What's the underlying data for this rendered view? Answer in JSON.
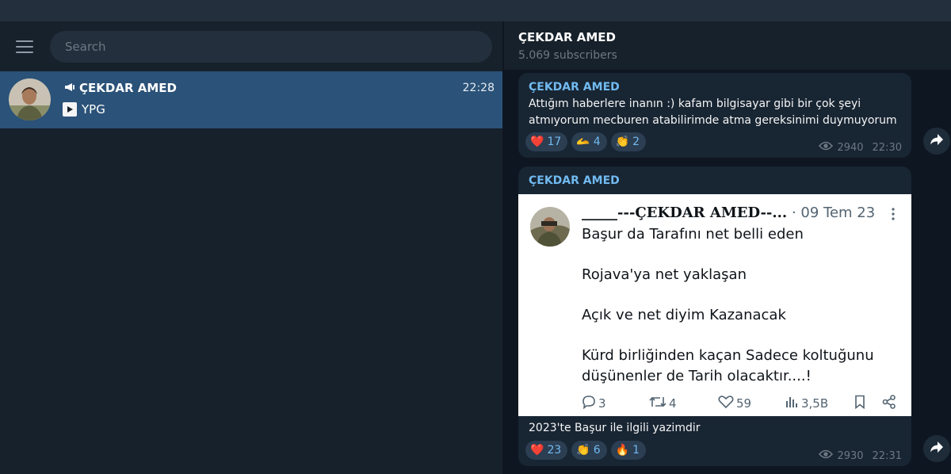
{
  "sidebar": {
    "search_placeholder": "Search",
    "chat": {
      "name": "ÇEKDAR AMED",
      "time": "22:28",
      "preview": "YPG"
    }
  },
  "header": {
    "title": "ÇEKDAR AMED",
    "subtitle": "5.069 subscribers"
  },
  "messages": [
    {
      "sender": "ÇEKDAR AMED",
      "text_line1": "Attığım haberlere inanın :) kafam bilgisayar gibi bir çok şeyi",
      "text_line2": "atmıyorum mecburen atabilirimde atma gereksinimi duymuyorum",
      "reactions": [
        {
          "emoji": "❤️",
          "count": "17"
        },
        {
          "emoji": "🫴",
          "count": "4"
        },
        {
          "emoji": "👏",
          "count": "2"
        }
      ],
      "views": "2940",
      "time": "22:30"
    },
    {
      "sender": "ÇEKDAR AMED",
      "tweet": {
        "display_name": "_____---ÇEKDAR AMED--...",
        "date": "· 09 Tem 23",
        "body": "Başur da Tarafını net belli eden\n\nRojava'ya net yaklaşan\n\nAçık ve net diyim Kazanacak\n\nKürd birliğinden kaçan Sadece koltuğunu\ndüşünenler de Tarih olacaktır....!",
        "replies": "3",
        "retweets": "4",
        "likes": "59",
        "views": "3,5B"
      },
      "caption": "2023'te Başur ile ilgili yazimdir",
      "reactions": [
        {
          "emoji": "❤️",
          "count": "23"
        },
        {
          "emoji": "👏",
          "count": "6"
        },
        {
          "emoji": "🔥",
          "count": "1"
        }
      ],
      "views": "2930",
      "time": "22:31"
    }
  ],
  "colors": {
    "accent": "#71baf0",
    "selected_chat": "#2b5278",
    "bubble": "#182533",
    "reaction_bg": "#2b3e52"
  }
}
